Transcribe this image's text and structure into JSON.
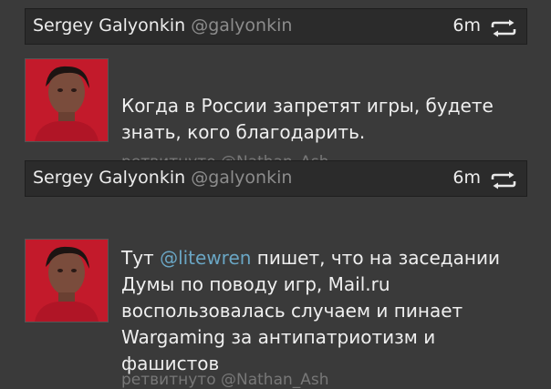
{
  "tweets": [
    {
      "author": "Sergey Galyonkin",
      "handle": "@galyonkin",
      "time": "6m",
      "icon": "retweet-icon",
      "text": "Когда в России запретят игры, будете знать, кого благодарить.",
      "retweeted_by": "ретвитнуто @Nathan_Ash"
    },
    {
      "author": "Sergey Galyonkin",
      "handle": "@galyonkin",
      "time": "6m",
      "icon": "retweet-icon",
      "text_before": "Тут ",
      "mention": "@litewren",
      "text_after": " пишет, что на заседании Думы по поводу игр, Mail.ru воспользовалась случаем и пинает Wargaming за антипатриотизм и фашистов",
      "retweeted_by": "ретвитнуто @Nathan_Ash"
    }
  ],
  "colors": {
    "background": "#3a3a3a",
    "header_bg": "#2b2b2b",
    "text": "#efefef",
    "handle": "#8c8c8c",
    "mention": "#6aa6c4",
    "meta": "#777777"
  }
}
